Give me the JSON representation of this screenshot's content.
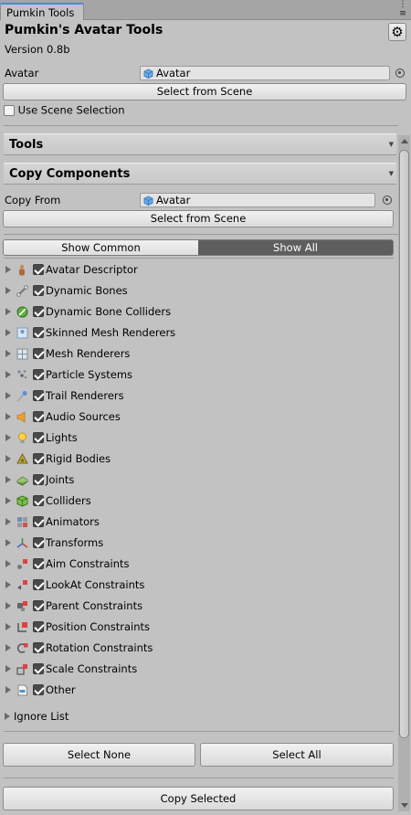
{
  "window": {
    "tab_title": "Pumkin Tools",
    "menu_icon": "kebab-menu-icon",
    "settings_icon": "gear-icon"
  },
  "header": {
    "title": "Pumkin's Avatar Tools",
    "version": "Version 0.8b"
  },
  "avatar": {
    "label": "Avatar",
    "value": "Avatar",
    "select_button": "Select from Scene",
    "use_scene_selection": "Use Scene Selection",
    "use_scene_selection_checked": false
  },
  "sections": {
    "tools": "Tools",
    "copy_components": "Copy Components"
  },
  "copy": {
    "from_label": "Copy From",
    "from_value": "Avatar",
    "select_button": "Select from Scene",
    "segments": [
      "Show Common",
      "Show All"
    ],
    "active_segment": "Show All"
  },
  "components": [
    {
      "label": "Avatar Descriptor",
      "icon": "avatar-descriptor-icon",
      "checked": true
    },
    {
      "label": "Dynamic Bones",
      "icon": "dynamic-bones-icon",
      "checked": true
    },
    {
      "label": "Dynamic Bone Colliders",
      "icon": "dynamic-bone-colliders-icon",
      "checked": true
    },
    {
      "label": "Skinned Mesh Renderers",
      "icon": "skinned-mesh-renderer-icon",
      "checked": true
    },
    {
      "label": "Mesh Renderers",
      "icon": "mesh-renderer-icon",
      "checked": true
    },
    {
      "label": "Particle Systems",
      "icon": "particle-system-icon",
      "checked": true
    },
    {
      "label": "Trail Renderers",
      "icon": "trail-renderer-icon",
      "checked": true
    },
    {
      "label": "Audio Sources",
      "icon": "audio-source-icon",
      "checked": true
    },
    {
      "label": "Lights",
      "icon": "light-icon",
      "checked": true
    },
    {
      "label": "Rigid Bodies",
      "icon": "rigidbody-icon",
      "checked": true
    },
    {
      "label": "Joints",
      "icon": "joint-icon",
      "checked": true
    },
    {
      "label": "Colliders",
      "icon": "collider-icon",
      "checked": true
    },
    {
      "label": "Animators",
      "icon": "animator-icon",
      "checked": true
    },
    {
      "label": "Transforms",
      "icon": "transform-icon",
      "checked": true
    },
    {
      "label": "Aim Constraints",
      "icon": "aim-constraint-icon",
      "checked": true
    },
    {
      "label": "LookAt Constraints",
      "icon": "lookat-constraint-icon",
      "checked": true
    },
    {
      "label": "Parent Constraints",
      "icon": "parent-constraint-icon",
      "checked": true
    },
    {
      "label": "Position Constraints",
      "icon": "position-constraint-icon",
      "checked": true
    },
    {
      "label": "Rotation Constraints",
      "icon": "rotation-constraint-icon",
      "checked": true
    },
    {
      "label": "Scale Constraints",
      "icon": "scale-constraint-icon",
      "checked": true
    },
    {
      "label": "Other",
      "icon": "script-icon",
      "checked": true
    }
  ],
  "ignore_list": "Ignore List",
  "buttons": {
    "select_none": "Select None",
    "select_all": "Select All",
    "copy_selected": "Copy Selected"
  },
  "colors": {
    "panel": "#c2c2c2",
    "tab_accent": "#4b89e0",
    "active_segment": "#5e5e5e"
  }
}
